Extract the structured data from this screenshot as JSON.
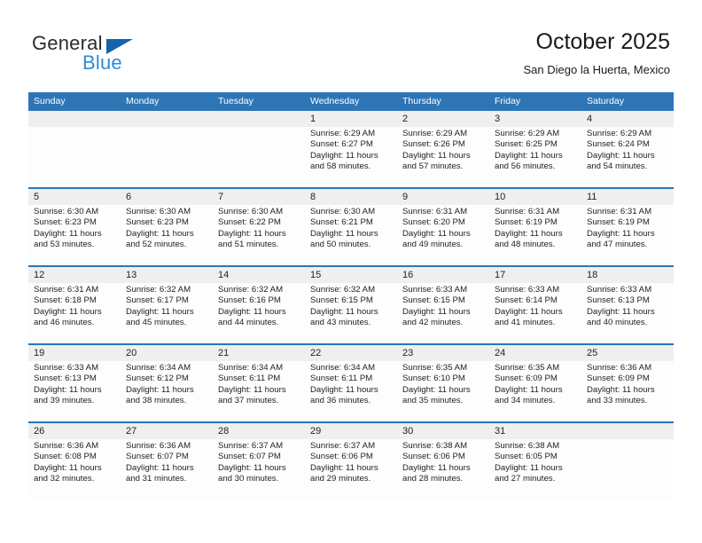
{
  "brand": {
    "name_part1": "General",
    "name_part2": "Blue",
    "flag_color": "#1565ad",
    "blue_color": "#2e8bd4"
  },
  "header": {
    "title": "October 2025",
    "subtitle": "San Diego la Huerta, Mexico",
    "accent_color": "#2e75b6",
    "daynum_band_color": "#efefef"
  },
  "weekdays": [
    "Sunday",
    "Monday",
    "Tuesday",
    "Wednesday",
    "Thursday",
    "Friday",
    "Saturday"
  ],
  "weeks": [
    {
      "days": [
        {
          "num": "",
          "sunrise": "",
          "sunset": "",
          "daylight1": "",
          "daylight2": ""
        },
        {
          "num": "",
          "sunrise": "",
          "sunset": "",
          "daylight1": "",
          "daylight2": ""
        },
        {
          "num": "",
          "sunrise": "",
          "sunset": "",
          "daylight1": "",
          "daylight2": ""
        },
        {
          "num": "1",
          "sunrise": "Sunrise: 6:29 AM",
          "sunset": "Sunset: 6:27 PM",
          "daylight1": "Daylight: 11 hours",
          "daylight2": "and 58 minutes."
        },
        {
          "num": "2",
          "sunrise": "Sunrise: 6:29 AM",
          "sunset": "Sunset: 6:26 PM",
          "daylight1": "Daylight: 11 hours",
          "daylight2": "and 57 minutes."
        },
        {
          "num": "3",
          "sunrise": "Sunrise: 6:29 AM",
          "sunset": "Sunset: 6:25 PM",
          "daylight1": "Daylight: 11 hours",
          "daylight2": "and 56 minutes."
        },
        {
          "num": "4",
          "sunrise": "Sunrise: 6:29 AM",
          "sunset": "Sunset: 6:24 PM",
          "daylight1": "Daylight: 11 hours",
          "daylight2": "and 54 minutes."
        }
      ]
    },
    {
      "days": [
        {
          "num": "5",
          "sunrise": "Sunrise: 6:30 AM",
          "sunset": "Sunset: 6:23 PM",
          "daylight1": "Daylight: 11 hours",
          "daylight2": "and 53 minutes."
        },
        {
          "num": "6",
          "sunrise": "Sunrise: 6:30 AM",
          "sunset": "Sunset: 6:23 PM",
          "daylight1": "Daylight: 11 hours",
          "daylight2": "and 52 minutes."
        },
        {
          "num": "7",
          "sunrise": "Sunrise: 6:30 AM",
          "sunset": "Sunset: 6:22 PM",
          "daylight1": "Daylight: 11 hours",
          "daylight2": "and 51 minutes."
        },
        {
          "num": "8",
          "sunrise": "Sunrise: 6:30 AM",
          "sunset": "Sunset: 6:21 PM",
          "daylight1": "Daylight: 11 hours",
          "daylight2": "and 50 minutes."
        },
        {
          "num": "9",
          "sunrise": "Sunrise: 6:31 AM",
          "sunset": "Sunset: 6:20 PM",
          "daylight1": "Daylight: 11 hours",
          "daylight2": "and 49 minutes."
        },
        {
          "num": "10",
          "sunrise": "Sunrise: 6:31 AM",
          "sunset": "Sunset: 6:19 PM",
          "daylight1": "Daylight: 11 hours",
          "daylight2": "and 48 minutes."
        },
        {
          "num": "11",
          "sunrise": "Sunrise: 6:31 AM",
          "sunset": "Sunset: 6:19 PM",
          "daylight1": "Daylight: 11 hours",
          "daylight2": "and 47 minutes."
        }
      ]
    },
    {
      "days": [
        {
          "num": "12",
          "sunrise": "Sunrise: 6:31 AM",
          "sunset": "Sunset: 6:18 PM",
          "daylight1": "Daylight: 11 hours",
          "daylight2": "and 46 minutes."
        },
        {
          "num": "13",
          "sunrise": "Sunrise: 6:32 AM",
          "sunset": "Sunset: 6:17 PM",
          "daylight1": "Daylight: 11 hours",
          "daylight2": "and 45 minutes."
        },
        {
          "num": "14",
          "sunrise": "Sunrise: 6:32 AM",
          "sunset": "Sunset: 6:16 PM",
          "daylight1": "Daylight: 11 hours",
          "daylight2": "and 44 minutes."
        },
        {
          "num": "15",
          "sunrise": "Sunrise: 6:32 AM",
          "sunset": "Sunset: 6:15 PM",
          "daylight1": "Daylight: 11 hours",
          "daylight2": "and 43 minutes."
        },
        {
          "num": "16",
          "sunrise": "Sunrise: 6:33 AM",
          "sunset": "Sunset: 6:15 PM",
          "daylight1": "Daylight: 11 hours",
          "daylight2": "and 42 minutes."
        },
        {
          "num": "17",
          "sunrise": "Sunrise: 6:33 AM",
          "sunset": "Sunset: 6:14 PM",
          "daylight1": "Daylight: 11 hours",
          "daylight2": "and 41 minutes."
        },
        {
          "num": "18",
          "sunrise": "Sunrise: 6:33 AM",
          "sunset": "Sunset: 6:13 PM",
          "daylight1": "Daylight: 11 hours",
          "daylight2": "and 40 minutes."
        }
      ]
    },
    {
      "days": [
        {
          "num": "19",
          "sunrise": "Sunrise: 6:33 AM",
          "sunset": "Sunset: 6:13 PM",
          "daylight1": "Daylight: 11 hours",
          "daylight2": "and 39 minutes."
        },
        {
          "num": "20",
          "sunrise": "Sunrise: 6:34 AM",
          "sunset": "Sunset: 6:12 PM",
          "daylight1": "Daylight: 11 hours",
          "daylight2": "and 38 minutes."
        },
        {
          "num": "21",
          "sunrise": "Sunrise: 6:34 AM",
          "sunset": "Sunset: 6:11 PM",
          "daylight1": "Daylight: 11 hours",
          "daylight2": "and 37 minutes."
        },
        {
          "num": "22",
          "sunrise": "Sunrise: 6:34 AM",
          "sunset": "Sunset: 6:11 PM",
          "daylight1": "Daylight: 11 hours",
          "daylight2": "and 36 minutes."
        },
        {
          "num": "23",
          "sunrise": "Sunrise: 6:35 AM",
          "sunset": "Sunset: 6:10 PM",
          "daylight1": "Daylight: 11 hours",
          "daylight2": "and 35 minutes."
        },
        {
          "num": "24",
          "sunrise": "Sunrise: 6:35 AM",
          "sunset": "Sunset: 6:09 PM",
          "daylight1": "Daylight: 11 hours",
          "daylight2": "and 34 minutes."
        },
        {
          "num": "25",
          "sunrise": "Sunrise: 6:36 AM",
          "sunset": "Sunset: 6:09 PM",
          "daylight1": "Daylight: 11 hours",
          "daylight2": "and 33 minutes."
        }
      ]
    },
    {
      "days": [
        {
          "num": "26",
          "sunrise": "Sunrise: 6:36 AM",
          "sunset": "Sunset: 6:08 PM",
          "daylight1": "Daylight: 11 hours",
          "daylight2": "and 32 minutes."
        },
        {
          "num": "27",
          "sunrise": "Sunrise: 6:36 AM",
          "sunset": "Sunset: 6:07 PM",
          "daylight1": "Daylight: 11 hours",
          "daylight2": "and 31 minutes."
        },
        {
          "num": "28",
          "sunrise": "Sunrise: 6:37 AM",
          "sunset": "Sunset: 6:07 PM",
          "daylight1": "Daylight: 11 hours",
          "daylight2": "and 30 minutes."
        },
        {
          "num": "29",
          "sunrise": "Sunrise: 6:37 AM",
          "sunset": "Sunset: 6:06 PM",
          "daylight1": "Daylight: 11 hours",
          "daylight2": "and 29 minutes."
        },
        {
          "num": "30",
          "sunrise": "Sunrise: 6:38 AM",
          "sunset": "Sunset: 6:06 PM",
          "daylight1": "Daylight: 11 hours",
          "daylight2": "and 28 minutes."
        },
        {
          "num": "31",
          "sunrise": "Sunrise: 6:38 AM",
          "sunset": "Sunset: 6:05 PM",
          "daylight1": "Daylight: 11 hours",
          "daylight2": "and 27 minutes."
        },
        {
          "num": "",
          "sunrise": "",
          "sunset": "",
          "daylight1": "",
          "daylight2": ""
        }
      ]
    }
  ]
}
